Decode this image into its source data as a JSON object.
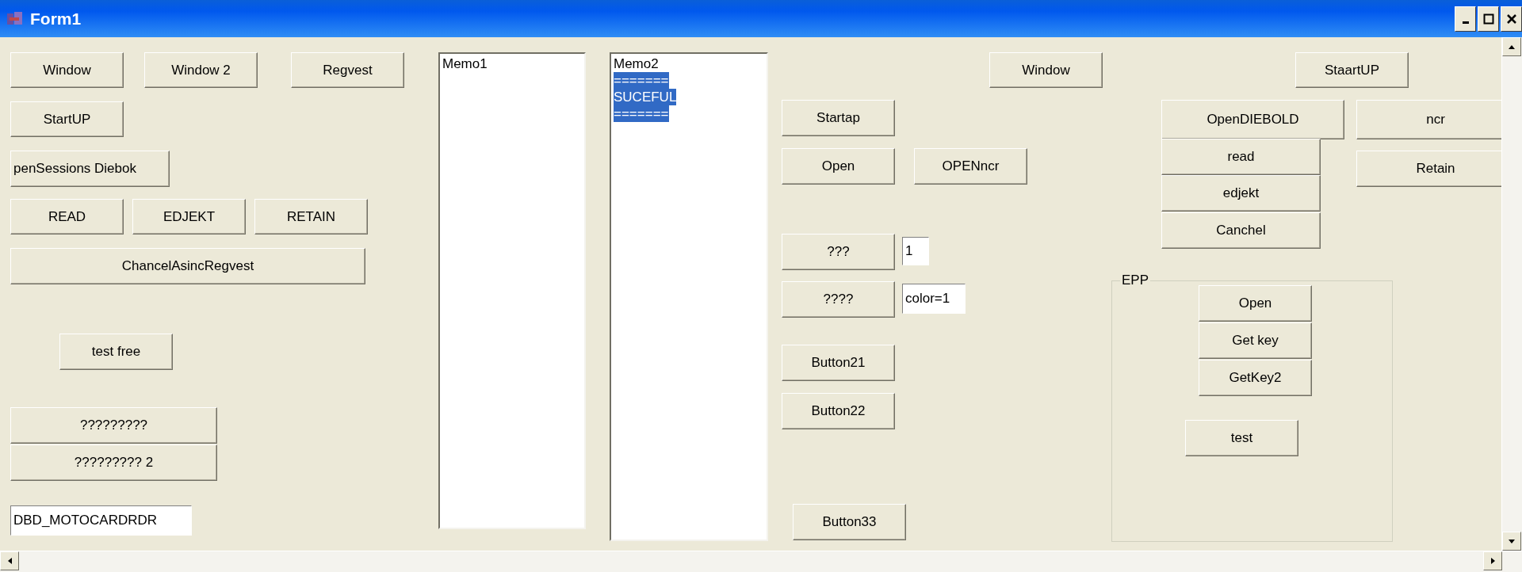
{
  "window": {
    "title": "Form1"
  },
  "controls": [
    {
      "kind": "button",
      "label": "Window"
    },
    {
      "kind": "button",
      "label": "Window 2"
    },
    {
      "kind": "button",
      "label": "Regvest"
    },
    {
      "kind": "button",
      "label": "StartUP"
    },
    {
      "kind": "button",
      "label": "penSessions Diebok"
    },
    {
      "kind": "button",
      "label": "READ"
    },
    {
      "kind": "button",
      "label": "EDJEKT"
    },
    {
      "kind": "button",
      "label": "RETAIN"
    },
    {
      "kind": "button",
      "label": "ChancelAsincRegvest"
    },
    {
      "kind": "button",
      "label": "test free"
    },
    {
      "kind": "button",
      "label": "?????????"
    },
    {
      "kind": "button",
      "label": "????????? 2"
    },
    {
      "kind": "edit",
      "value": "DBD_MOTOCARDRDR"
    },
    {
      "kind": "memo",
      "lines": [
        {
          "text": "Memo1",
          "selected": false
        }
      ]
    },
    {
      "kind": "memo",
      "lines": [
        {
          "text": "Memo2",
          "selected": false
        },
        {
          "text": "=======",
          "selected": true
        },
        {
          "text": "SUCEFUL",
          "selected": true
        },
        {
          "text": "=======",
          "selected": true
        }
      ]
    },
    {
      "kind": "button",
      "label": "Window"
    },
    {
      "kind": "button",
      "label": "StaartUP"
    },
    {
      "kind": "button",
      "label": "Startap"
    },
    {
      "kind": "button",
      "label": "Open"
    },
    {
      "kind": "button",
      "label": "OPENncr"
    },
    {
      "kind": "button",
      "label": "OpenDIEBOLD"
    },
    {
      "kind": "button",
      "label": "ncr"
    },
    {
      "kind": "button",
      "label": "read"
    },
    {
      "kind": "button",
      "label": "Retain"
    },
    {
      "kind": "button",
      "label": "edjekt"
    },
    {
      "kind": "button",
      "label": "Canchel"
    },
    {
      "kind": "button",
      "label": "???"
    },
    {
      "kind": "edit",
      "value": "1"
    },
    {
      "kind": "button",
      "label": "????"
    },
    {
      "kind": "edit",
      "value": "color=1"
    },
    {
      "kind": "button",
      "label": "Button21"
    },
    {
      "kind": "button",
      "label": "Button22"
    },
    {
      "kind": "button",
      "label": "Button33"
    },
    {
      "kind": "group",
      "label": "EPP",
      "children": [
        {
          "kind": "button",
          "label": "Open"
        },
        {
          "kind": "button",
          "label": "Get key"
        },
        {
          "kind": "button",
          "label": "GetKey2"
        },
        {
          "kind": "button",
          "label": "test"
        }
      ]
    }
  ]
}
